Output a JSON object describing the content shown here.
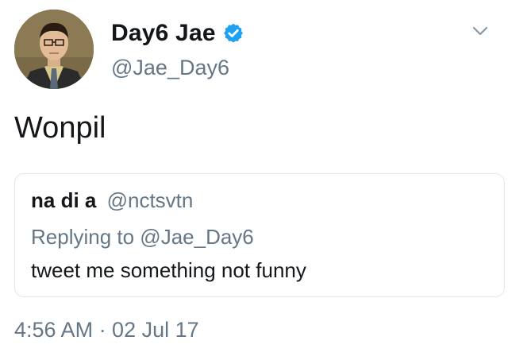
{
  "tweet": {
    "author": {
      "display_name": "Day6 Jae",
      "handle": "@Jae_Day6",
      "verified": true,
      "avatar_icon": "person-portrait-icon"
    },
    "menu_icon": "chevron-down-icon",
    "text": "Wonpil",
    "quoted_tweet": {
      "display_name": "na di a",
      "handle": "@nctsvtn",
      "replying_to": "Replying to @Jae_Day6",
      "text": "tweet me something not funny"
    },
    "timestamp": "4:56 AM · 02 Jul 17"
  },
  "colors": {
    "text_primary": "#14171a",
    "text_secondary": "#657786",
    "verified_blue": "#1da1f2",
    "border": "#e1e8ed"
  }
}
